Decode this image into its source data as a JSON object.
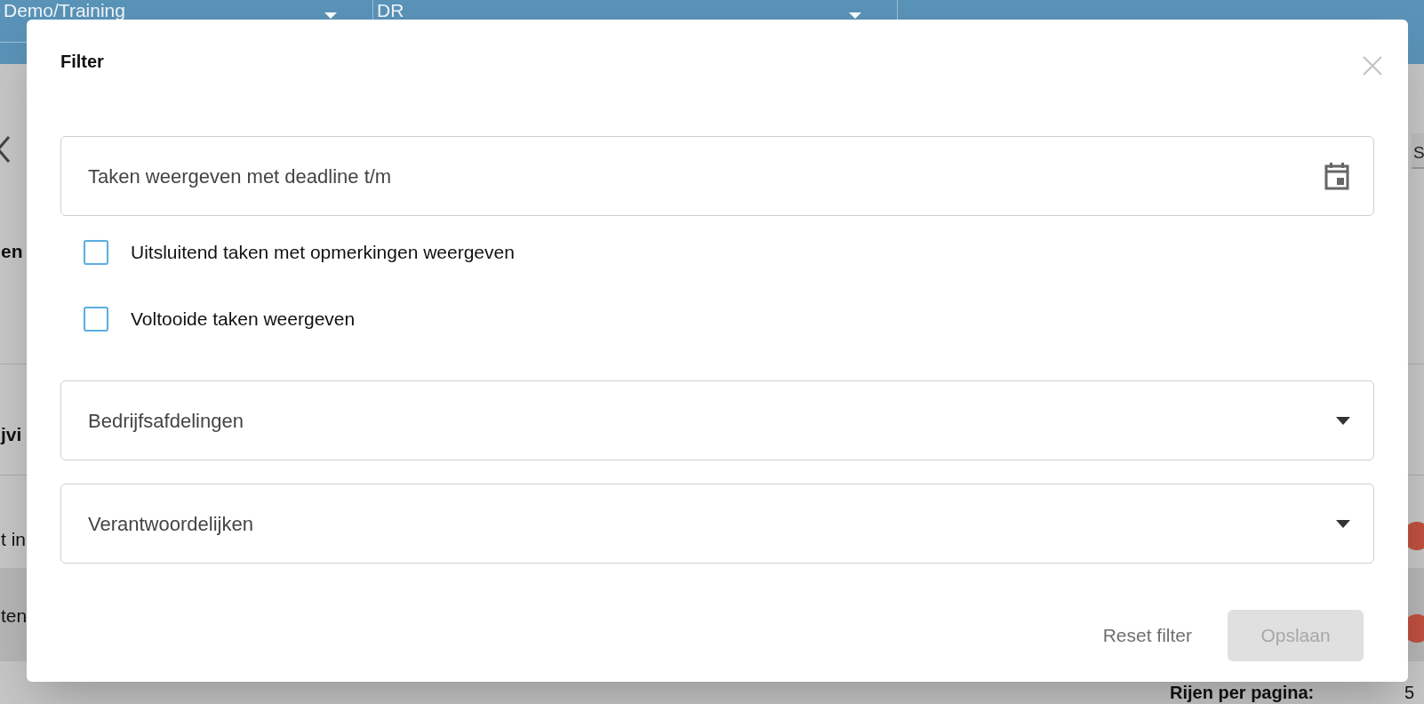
{
  "background": {
    "top_bar": {
      "dropdowns": [
        {
          "value": "Demo/Training"
        },
        {
          "value": "DR"
        }
      ]
    },
    "left_fragments": [
      {
        "text": "en",
        "bold": true
      },
      {
        "text": "jvi",
        "bold": true
      },
      {
        "text": "t in",
        "bold": false
      },
      {
        "text": "ten",
        "bold": false
      }
    ],
    "right_button": "S",
    "status_dots": [
      {
        "color": "#c0503f"
      },
      {
        "color": "#c0503f"
      }
    ],
    "pagination": {
      "label": "Rijen per pagina:",
      "value": "5"
    }
  },
  "dialog": {
    "title": "Filter",
    "date_field": {
      "placeholder": "Taken weergeven met deadline t/m"
    },
    "checkboxes": [
      {
        "label": "Uitsluitend taken met opmerkingen weergeven",
        "checked": false
      },
      {
        "label": "Voltooide taken weergeven",
        "checked": false
      }
    ],
    "selects": [
      {
        "placeholder": "Bedrijfsafdelingen"
      },
      {
        "placeholder": "Verantwoordelijken"
      }
    ],
    "buttons": [
      {
        "label": "Reset filter",
        "kind": "text",
        "disabled": false
      },
      {
        "label": "Opslaan",
        "kind": "filled",
        "disabled": true
      }
    ]
  }
}
